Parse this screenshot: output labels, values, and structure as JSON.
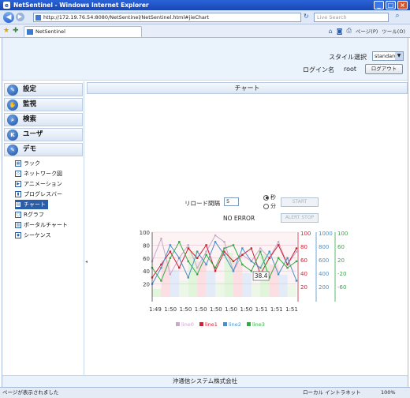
{
  "window": {
    "title": "NetSentinel - Windows Internet Explorer"
  },
  "browser": {
    "url": "http://172.19.76.54:8080/NetSentinel/NetSentinel.html#jieChart",
    "search_placeholder": "Live Search",
    "tab_title": "NetSentinel",
    "page_menu": "ページ(P)",
    "tools_menu": "ツール(O)"
  },
  "header": {
    "style_label": "スタイル選択",
    "style_value": "standard",
    "login_label": "ログイン名",
    "login_user": "root",
    "logout_label": "ログアウト"
  },
  "sidebar": {
    "menus": [
      {
        "label": "設定",
        "icon": "wrench-icon"
      },
      {
        "label": "監視",
        "icon": "hand-icon"
      },
      {
        "label": "検索",
        "icon": "magnifier-icon"
      },
      {
        "label": "ユーザ",
        "icon": "user-k-icon"
      },
      {
        "label": "デモ",
        "icon": "wrench-icon"
      }
    ],
    "demo_items": [
      {
        "label": "ラック"
      },
      {
        "label": "ネットワーク図"
      },
      {
        "label": "アニメーション"
      },
      {
        "label": "プログレスバー"
      },
      {
        "label": "チャート",
        "active": true
      },
      {
        "label": "Rグラフ"
      },
      {
        "label": "ポータルチャート"
      },
      {
        "label": "シーケンス"
      }
    ]
  },
  "main": {
    "panel_title": "チャート",
    "reload_label": "リロード間隔",
    "reload_value": "5",
    "unit_seconds": "秒",
    "unit_minutes": "分",
    "start_label": "START",
    "alert_stop_label": "ALERT STOP",
    "status_text": "NO ERROR"
  },
  "chart_data": {
    "type": "line",
    "x": [
      "1:49",
      "1:50",
      "1:50",
      "1:50",
      "1:50",
      "1:50",
      "1:50",
      "1:51",
      "1:51",
      "1:51"
    ],
    "y_axes": [
      {
        "ticks": [
          20,
          40,
          60,
          80,
          100
        ],
        "color": "#333333"
      },
      {
        "ticks": [
          20,
          40,
          60,
          80,
          100
        ],
        "color": "#cc2233"
      },
      {
        "ticks": [
          200,
          400,
          600,
          800,
          1000
        ],
        "color": "#4a90c8"
      },
      {
        "ticks": [
          -60,
          -20,
          20,
          60,
          100
        ],
        "color": "#33aa44"
      }
    ],
    "series": [
      {
        "name": "line0",
        "color": "#c9a9c9",
        "values": [
          55,
          90,
          35,
          60,
          80,
          45,
          70,
          95,
          85,
          40,
          65,
          55,
          75,
          60,
          85,
          50,
          70
        ]
      },
      {
        "name": "line1",
        "color": "#cc2233",
        "values": [
          30,
          50,
          70,
          45,
          75,
          60,
          80,
          40,
          70,
          55,
          65,
          75,
          35,
          60,
          80,
          50,
          75
        ]
      },
      {
        "name": "line2",
        "color": "#4a90c8",
        "values": [
          20,
          45,
          80,
          60,
          30,
          70,
          50,
          85,
          65,
          40,
          75,
          55,
          45,
          70,
          35,
          60,
          25
        ]
      },
      {
        "name": "line3",
        "color": "#33aa44",
        "values": [
          45,
          25,
          60,
          85,
          55,
          35,
          65,
          45,
          75,
          80,
          50,
          40,
          70,
          30,
          60,
          45,
          55
        ]
      }
    ],
    "tooltip": "38.4",
    "ylim": [
      0,
      100
    ],
    "grid": true,
    "legend": "bottom"
  },
  "footer": {
    "company": "沖通信システム株式会社"
  },
  "statusbar": {
    "left": "ページが表示されました",
    "zone": "ローカル イントラネット",
    "zoom": "100%"
  }
}
